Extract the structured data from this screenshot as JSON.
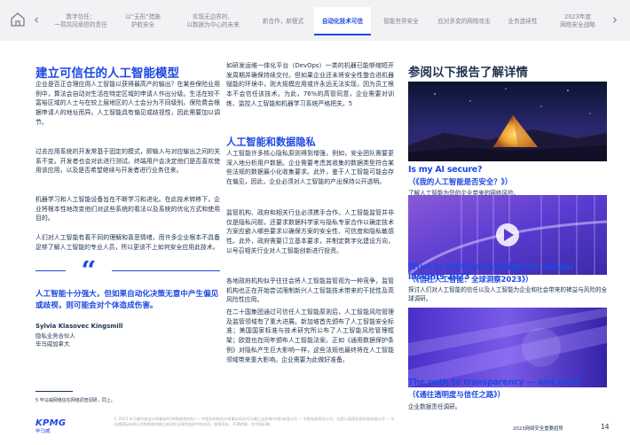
{
  "nav": {
    "tabs": [
      {
        "label": "数字信任：\n一项共同承担的责任"
      },
      {
        "label": "以“无形”措施\n护航安全"
      },
      {
        "label": "实现无边界的、\n以数据为中心的未来"
      },
      {
        "label": "新合作，新模式"
      },
      {
        "label": "自动化技术可信"
      },
      {
        "label": "智能世界安全"
      },
      {
        "label": "应对多变的网络攻击"
      },
      {
        "label": "业务连续性"
      },
      {
        "label": "2023年度\n网络安全战略"
      }
    ]
  },
  "left": {
    "heading": "建立可信任的人工智能模型",
    "p1": "企业是否正合理应用人工智能以获得最高产的输出？在某些保险业用例中，算法会自动对生活在特定区域的申请人作出分级。生活在较不富裕区域的人士与在较上层地区的人士会分为不同级别。保险费会根据申请人的地址而异。人工智能具有偏见或歧视性，因此需要加以调节。",
    "p2": "过去应用系统的开发常基于固定的模式，即输入与对应输出之间的关系不变。开发者也会对此进行测试。终端用户会决定他们是否喜欢使用该应用，以及是否希望继续与开发者进行业务往来。",
    "p3": "机器学习和人工智能设备旨在不断学习和进化。在此技术转移下，企业将根本性地改变他们对这些系统的看法以及系统的优化方式和使用目的。",
    "p4": "人们对人工智能有着不同的理解和喜恶情绪，而许多企业根本不具备足够了解人工智能的专业人员，所以更该不上如何安全应用此技术。",
    "quote_mark": "“",
    "quote": "人工智能十分强大，但如果自动化决策无意中产生偏见或歧视，则可能会对个体造成伤害。",
    "author_name": "Sylvia Klasovec Kingsmill",
    "author_title": "隐私业务合伙人",
    "author_org": "毕马威加拿大",
    "footnote": "5 毕马威网络信任网络调查调研，同上。"
  },
  "middle": {
    "p1": "如研发运维一体化平台（DevOps）一类的机器已能够缩短开发周期并确保持续交付。但如果企业还未将安全性整合进机器赋能的环境中，则大规模应用或许永远无法实现，因为员工根本不会信任该技术。为此，76%的高管同意，企业需要对训练、监控人工智能和机器学习系统严格把关。5",
    "heading": "人工智能和数据隐私",
    "p2": "人工智能许多核心隐私原则得到增强，例如，安全团队需要更深入地分析用户数据。企业需要考虑其收集的数据类型符合某些法规的数据最小化收集要求。此外，鉴于人工智能可能会存在偏见，因此，企业必须对人工智能的产出保持公开透明。",
    "p3": "监管机构、政府和相关行业必须携手合作。人工智能监管并非仅是隐私问题，还要求数据科学家与隐私专家合作以确定技术方案应嵌入哪些要求以确保方案的安全性、可信度和隐私敏感性。此外，政府需要订立基本要求，并制定数字化建设方向，以号召相关行业对人工智能创新进行投资。",
    "p4": "各地政府机构似乎往往会将人工智能监管视为一种竞争，监管机构也正在开始尝试限制新兴人工智能技术带来的干扰性及高风险性应用。",
    "p5": "在二十国集团通过可信任人工智能原则后，人工智能风险管理及监管领域有了重大进展。新加坡首先颁布了人工智能安全标准；美国国家标准与技术研究所公布了人工智能风险管理框架；欧盟也在同年颁布人工智能法案。正如《通用数据保护条例》对隐私产生巨大影响一样，这些法规也最终将在人工智能领域带来重大影响。企业需要为此做好准备。"
  },
  "right": {
    "heading": "参阅以下报告了解详情",
    "reports": [
      {
        "title_en": "Is my AI secure?",
        "title_cn": "（《我的人工智能是否安全？》）",
        "desc": "了解人工智能为您的企业带来的网络风险。"
      },
      {
        "title_en": "Trust in artificial intelligence: Global insights 2023",
        "title_cn": "（《信任人工智能：全球洞察2023》）",
        "desc": "探讨人们对人工智能的信任以及人工智能为企业和社会带来的裨益与风险的全球调研。"
      },
      {
        "title_en": "The path to transparency — and trust",
        "title_cn": "（《通往透明度与信任之路》）",
        "desc": "企业数据责任调研。"
      }
    ]
  },
  "footer": {
    "logo": "KPMG",
    "logo_cn": "毕马威",
    "legal": "© 2023 毕马威华振会计师事务所(特殊普通合伙) — 中国合伙制会计师事务所及毕马威企业咨询(中国)有限公司 — 中国有限责任公司，均是与英国私营担保有限公司 — 毕马威国际有限公司相关联的独立成员所全球性组织中的成员。版权所有，不得转载。在中国印刷。",
    "report_title": "2023网络安全重要趋势",
    "page": "14"
  },
  "colors": {
    "accent": "#1e49e2",
    "text": "#1e3250",
    "nav_bg": "#f2f2f4"
  }
}
